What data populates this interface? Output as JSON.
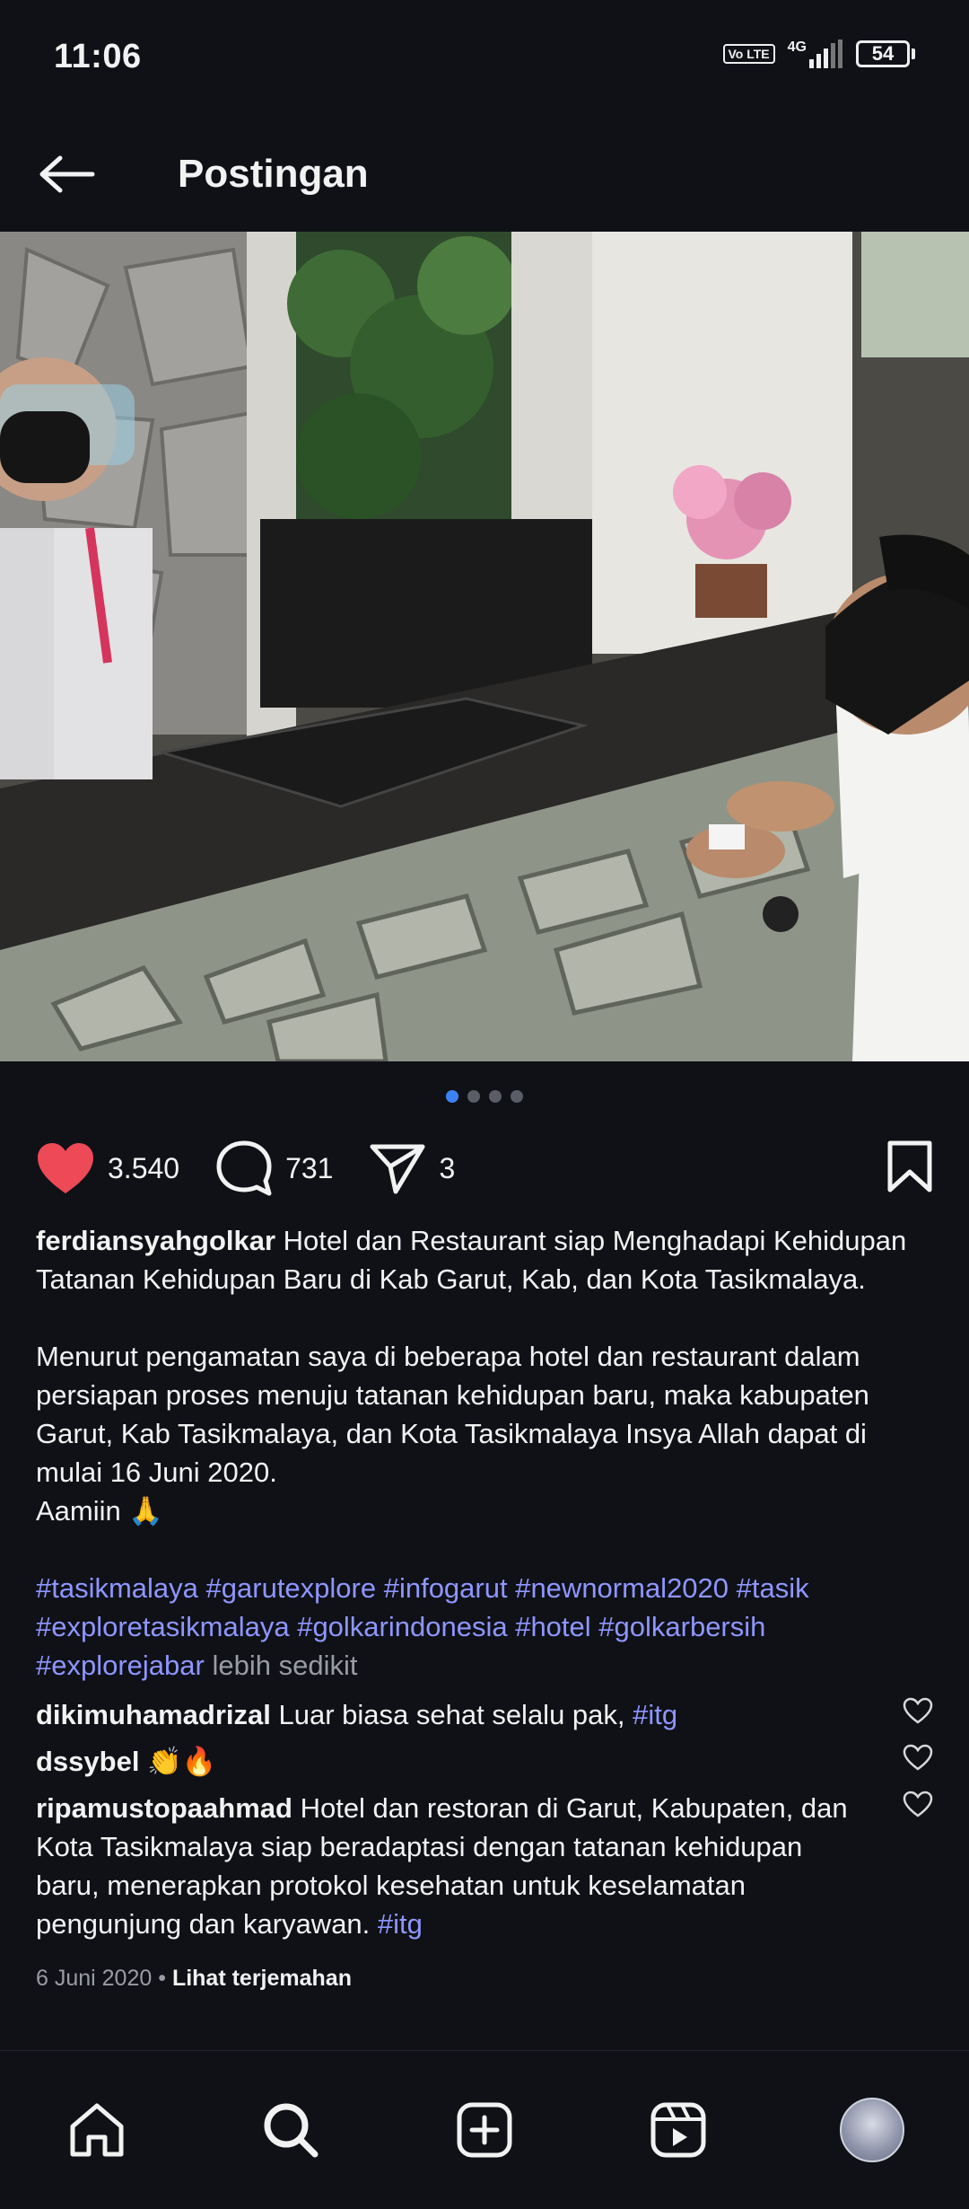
{
  "status_bar": {
    "time": "11:06",
    "network": "4G",
    "volte": "Vo LTE",
    "battery": "54"
  },
  "header": {
    "title": "Postingan",
    "back_icon": "arrow-left-icon"
  },
  "post": {
    "image_count": 4,
    "active_image": 1,
    "likes": "3.540",
    "comments": "731",
    "shares": "3",
    "caption": {
      "username": "ferdiansyahgolkar",
      "line1": "Hotel dan Restaurant siap Menghadapi Kehidupan Tatanan Kehidupan Baru di Kab Garut, Kab, dan Kota Tasikmalaya.",
      "paragraph2": "Menurut pengamatan saya di beberapa hotel dan restaurant dalam persiapan proses menuju tatanan kehidupan baru,  maka kabupaten Garut, Kab Tasikmalaya,  dan Kota Tasikmalaya Insya Allah dapat di mulai 16 Juni 2020.",
      "paragraph3": "Aamiin 🙏",
      "hashtags": "#tasikmalaya #garutexplore #infogarut #newnormal2020 #tasik #exploretasikmalaya #golkarindonesia #hotel #golkarbersih #explorejabar",
      "less": "lebih sedikit"
    },
    "comments_list": [
      {
        "username": "dikimuhamadrizal",
        "text": "Luar biasa sehat selalu pak,",
        "tag": "#itg"
      },
      {
        "username": "dssybel",
        "text": "👏🔥",
        "tag": ""
      },
      {
        "username": "ripamustopaahmad",
        "text": "Hotel dan restoran di Garut, Kabupaten, dan Kota Tasikmalaya siap beradaptasi dengan tatanan kehidupan baru, menerapkan protokol kesehatan untuk keselamatan pengunjung dan karyawan.",
        "tag": "#itg"
      }
    ],
    "date": "6 Juni 2020",
    "translate": "Lihat terjemahan"
  },
  "colors": {
    "background": "#0f1117",
    "like": "#ed4956",
    "hashtag": "#8f96ff",
    "dot_active": "#3c82f6"
  },
  "bottom_nav": [
    "home-icon",
    "search-icon",
    "add-post-icon",
    "reels-icon",
    "profile-avatar"
  ]
}
